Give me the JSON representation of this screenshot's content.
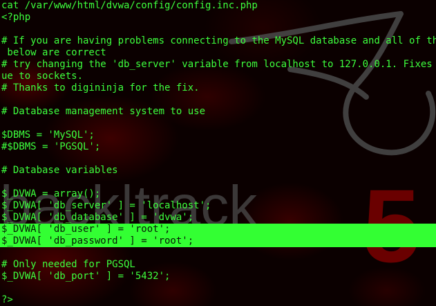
{
  "terminal": {
    "lines": [
      "cat /var/www/html/dvwa/config/config.inc.php",
      "<?php",
      "",
      "# If you are having problems connecting to the MySQL database and all of the va",
      " below are correct",
      "# try changing the 'db_server' variable from localhost to 127.0.0.1. Fixes a pr",
      "ue to sockets.",
      "# Thanks to digininja for the fix.",
      "",
      "# Database management system to use",
      "",
      "$DBMS = 'MySQL';",
      "#$DBMS = 'PGSQL';",
      "",
      "# Database variables",
      "",
      "$_DVWA = array();",
      "$_DVWA[ 'db_server' ] = 'localhost';",
      "$_DVWA[ 'db_database' ] = 'dvwa';",
      "$_DVWA[ 'db_user' ] = 'root';",
      "$_DVWA[ 'db_password' ] = 'root';",
      "",
      "# Only needed for PGSQL",
      "$_DVWA[ 'db_port' ] = '5432';",
      "",
      "?>"
    ],
    "highlighted_line_indices": [
      19,
      20
    ]
  },
  "wallpaper": {
    "brand_word": "back|track",
    "brand_number": "5"
  },
  "colors": {
    "text": "#3dff3d",
    "highlight_bg": "#33ff33",
    "highlight_text": "#061a06",
    "background": "#0b0000"
  }
}
